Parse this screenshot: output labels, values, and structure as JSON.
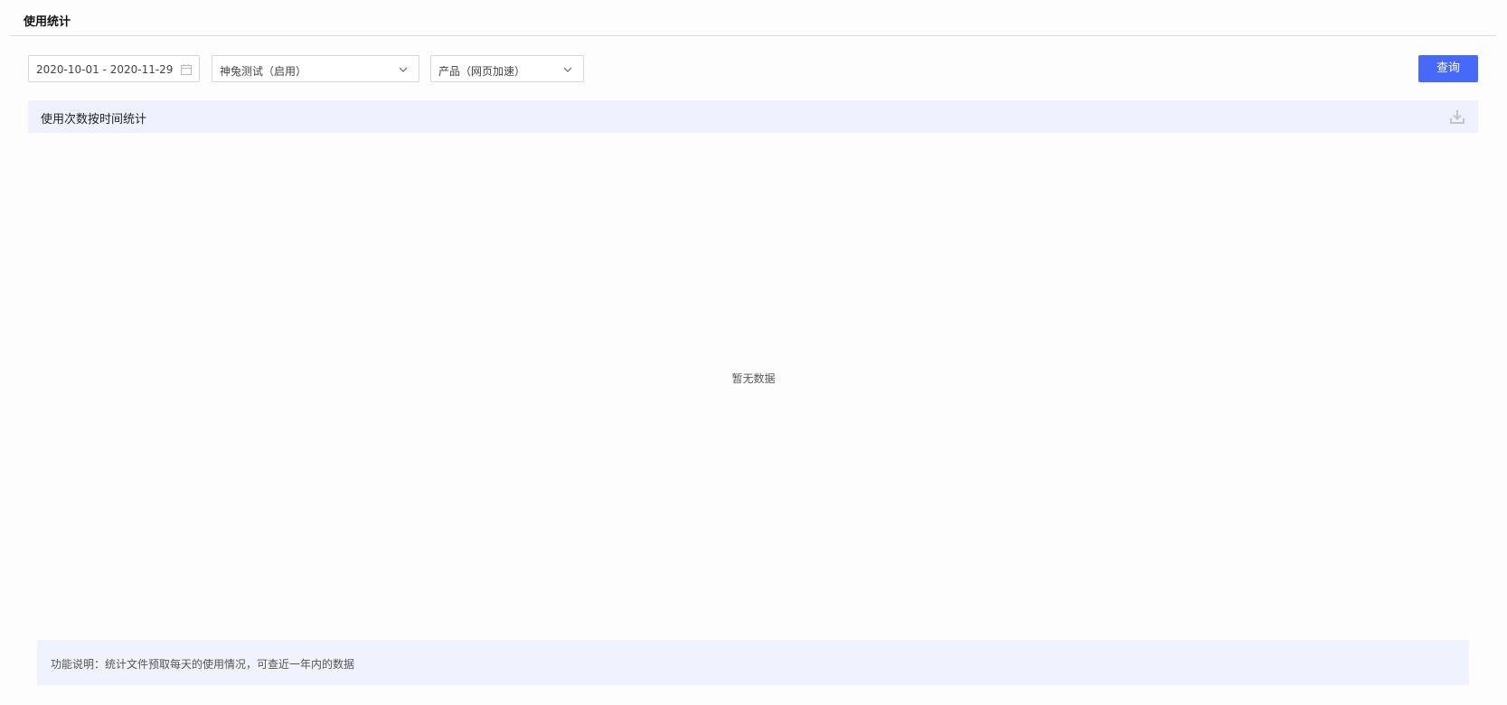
{
  "header": {
    "title": "使用统计"
  },
  "filters": {
    "date_range": "2020-10-01 - 2020-11-29",
    "select_app": "神兔测试（启用）",
    "select_product": "产品（网页加速）",
    "query_label": "查询"
  },
  "section": {
    "title": "使用次数按时间统计"
  },
  "chart": {
    "empty_text": "暂无数据"
  },
  "note": {
    "text": "功能说明：统计文件预取每天的使用情况，可查近一年内的数据"
  },
  "icons": {
    "date": "calendar-icon",
    "dropdown": "chevron-down-icon",
    "download": "download-icon"
  },
  "colors": {
    "primary": "#4669fb",
    "section_bg": "#eef2fe",
    "note_bg": "#f0f3fd"
  }
}
